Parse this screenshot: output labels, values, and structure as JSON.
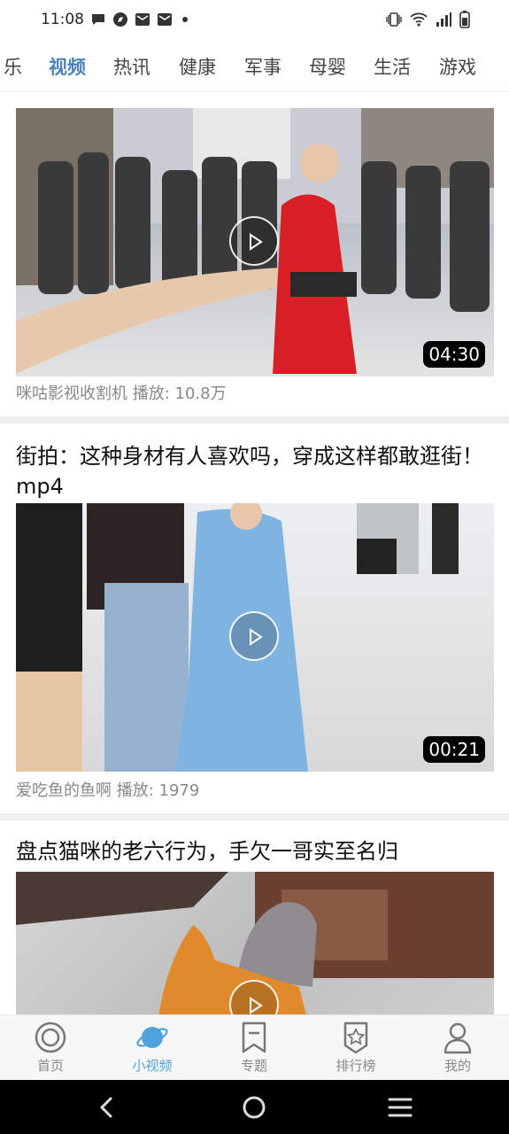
{
  "status_bar": {
    "time": "11:08"
  },
  "tabs": [
    {
      "label": "乐"
    },
    {
      "label": "视频",
      "active": true
    },
    {
      "label": "热讯"
    },
    {
      "label": "健康"
    },
    {
      "label": "军事"
    },
    {
      "label": "母婴"
    },
    {
      "label": "生活"
    },
    {
      "label": "游戏"
    }
  ],
  "feed": [
    {
      "title": "",
      "author_views": "咪咕影视收割机 播放: 10.8万",
      "duration": "04:30"
    },
    {
      "title": "街拍：这种身材有人喜欢吗，穿成这样都敢逛街！mp4",
      "author_views": "爱吃鱼的鱼啊 播放: 1979",
      "duration": "00:21"
    },
    {
      "title": "盘点猫咪的老六行为，手欠一哥实至名归",
      "author_views": "",
      "duration": ""
    }
  ],
  "bottom_nav": [
    {
      "label": "首页",
      "icon": "home-circle-icon"
    },
    {
      "label": "小视频",
      "icon": "planet-icon",
      "active": true
    },
    {
      "label": "专题",
      "icon": "bookmark-icon"
    },
    {
      "label": "排行榜",
      "icon": "star-badge-icon"
    },
    {
      "label": "我的",
      "icon": "user-icon"
    }
  ],
  "colors": {
    "accent": "#4a83b7",
    "nav_active": "#4fa3dd",
    "separator": "#eeeeee"
  }
}
